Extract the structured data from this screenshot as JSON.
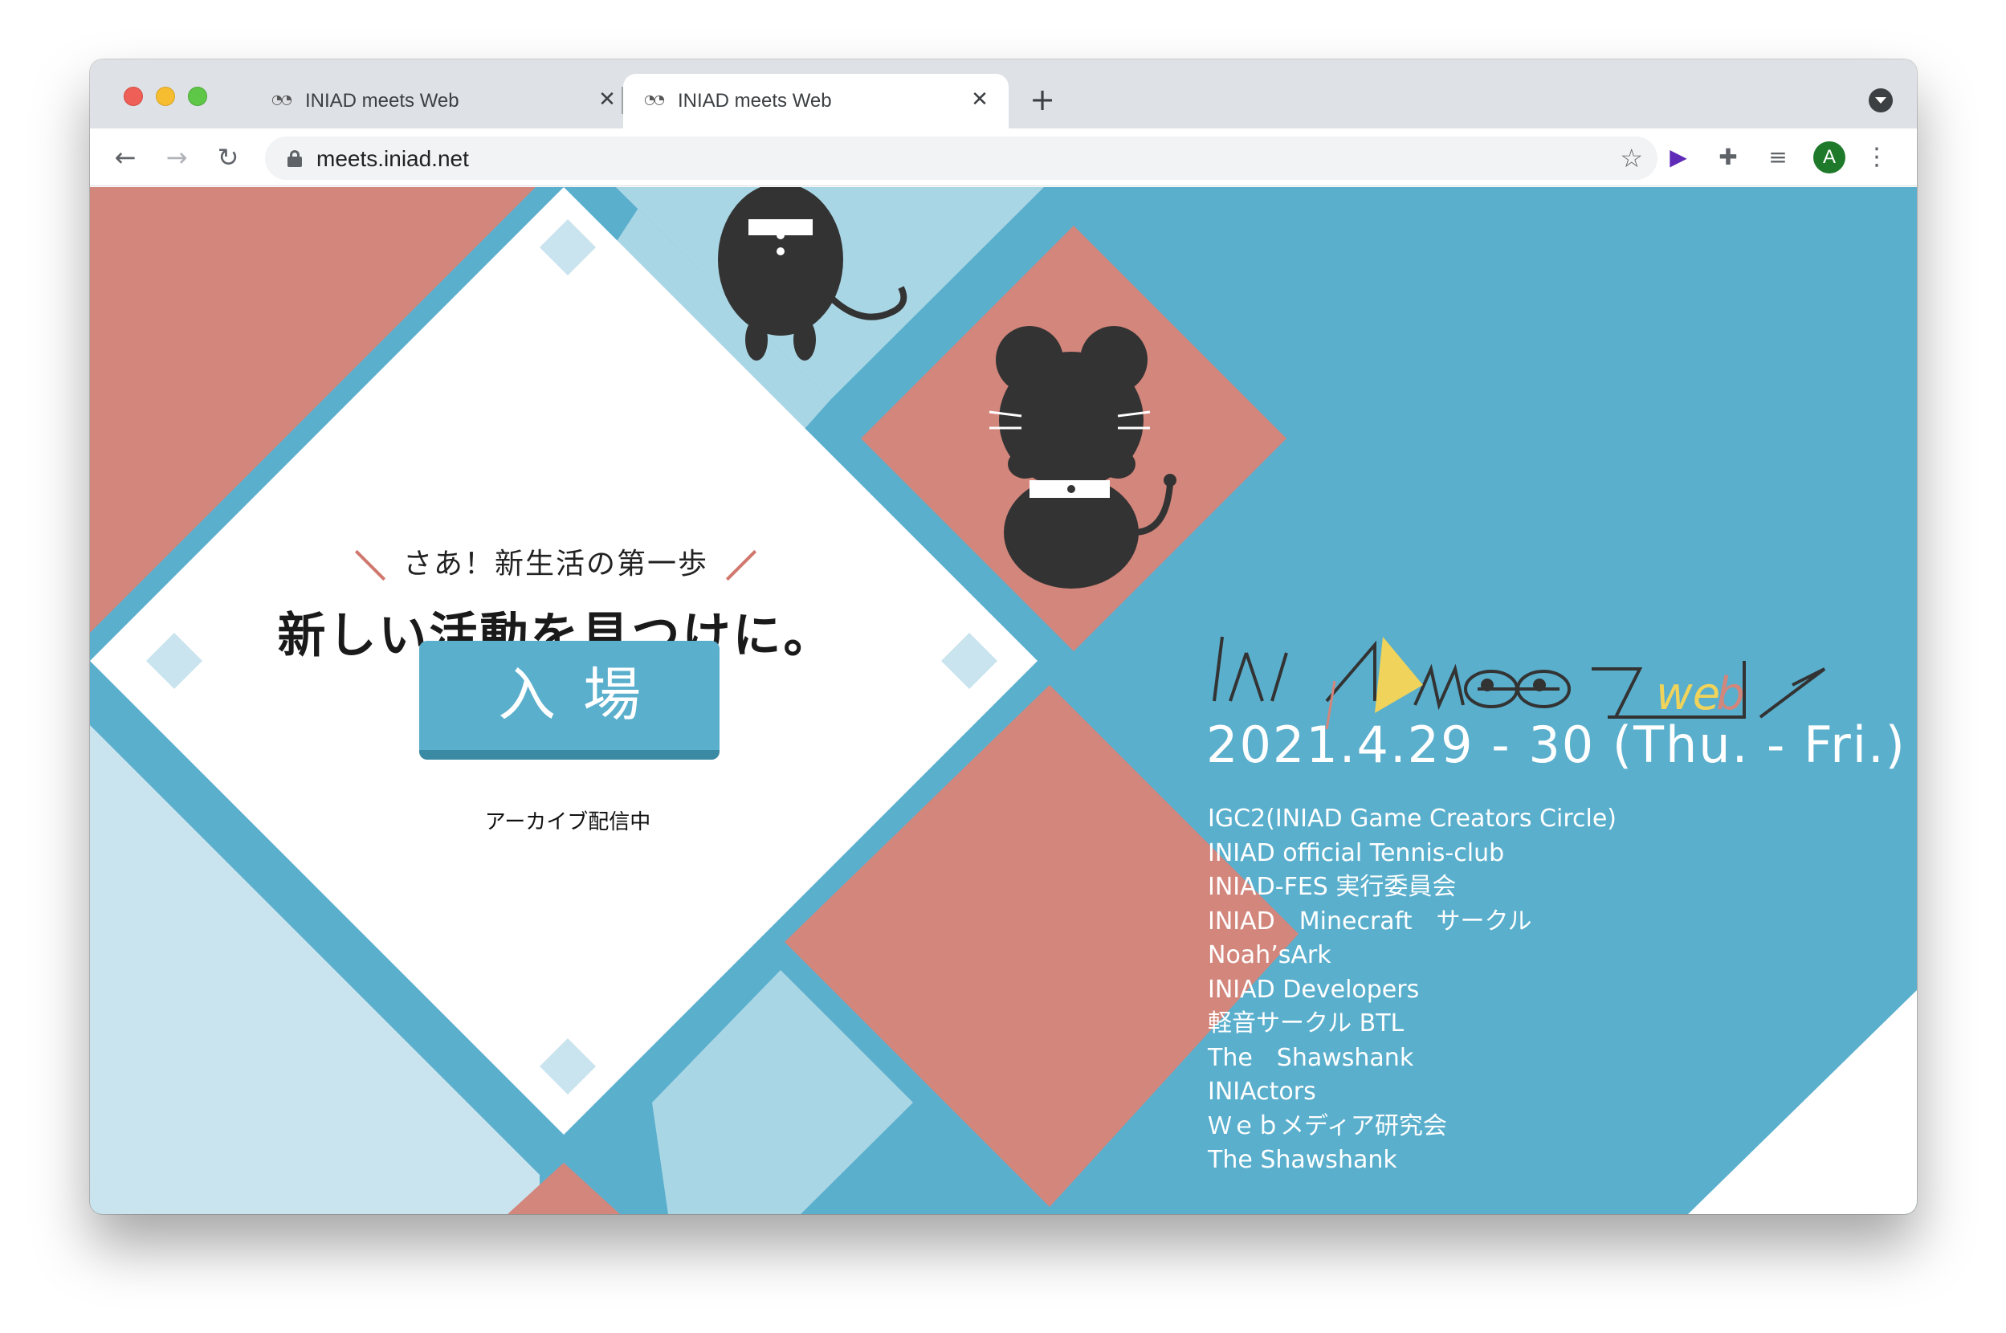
{
  "browser": {
    "tabs": [
      {
        "title": "INIAD meets Web",
        "favicon": "eyes-icon",
        "active": false
      },
      {
        "title": "INIAD meets Web",
        "favicon": "eyes-icon",
        "active": true
      }
    ],
    "new_tab_glyph": "+",
    "url": "meets.iniad.net",
    "avatar_initial": "A",
    "icons": {
      "back": "←",
      "forward": "→",
      "reload": "↻",
      "star": "☆",
      "close": "✕",
      "menu": "⋮",
      "cast": "▶",
      "puzzle": "✚",
      "media": "≡"
    }
  },
  "page": {
    "catch_small": "さあ！新生活の第一歩",
    "catch_big": "新しい活動を見つけに。",
    "enter_label": "入場",
    "archive_note": "アーカイブ配信中",
    "logo_text": "INIAD meets web",
    "event_date": "2021.4.29 - 30 (Thu. - Fri.)",
    "circles": [
      "IGC2(INIAD Game Creators Circle)",
      "INIAD official Tennis-club",
      "INIAD-FES 実行委員会",
      "INIAD　Minecraft　サークル",
      "Noah’sArk",
      "INIAD Developers",
      "軽音サークル BTL",
      "The　Shawshank",
      "INIActors",
      "Ｗｅｂメディア研究会",
      "The Shawshank"
    ]
  },
  "colors": {
    "page_blue": "#5aafcd",
    "light_blue": "#a9d6e5",
    "pale_blue": "#c9e4ee",
    "salmon": "#d3867c",
    "mascot": "#333333",
    "logo_yellow": "#f0d35a"
  }
}
